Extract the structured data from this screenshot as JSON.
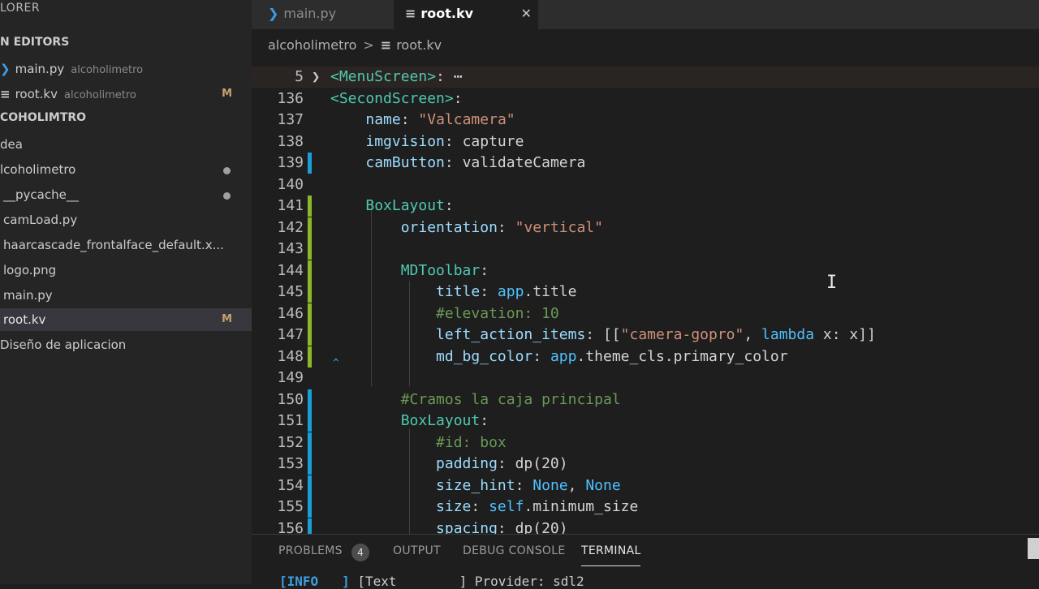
{
  "sidebar": {
    "explorer_title": "LORER",
    "open_editors_header": "N EDITORS",
    "open_editors": [
      {
        "icon": "python-file-icon",
        "name": "main.py",
        "description": "alcoholimetro",
        "modified": ""
      },
      {
        "icon": "kv-file-icon",
        "name": "root.kv",
        "description": "alcoholimetro",
        "modified": "M"
      }
    ],
    "project_header": "COHOLIMTRO",
    "tree": [
      {
        "name": "dea",
        "badge": "",
        "dot": false
      },
      {
        "name": "lcoholimetro",
        "badge": "",
        "dot": true
      },
      {
        "name": "__pycache__",
        "badge": "",
        "dot": true
      },
      {
        "name": "camLoad.py",
        "badge": "",
        "dot": false
      },
      {
        "name": "haarcascade_frontalface_default.x...",
        "badge": "",
        "dot": false
      },
      {
        "name": "logo.png",
        "badge": "",
        "dot": false
      },
      {
        "name": "main.py",
        "badge": "",
        "dot": false
      },
      {
        "name": "root.kv",
        "badge": "M",
        "dot": false
      },
      {
        "name": "Diseño de aplicacion",
        "badge": "",
        "dot": false
      }
    ]
  },
  "tabs": {
    "main": "main.py",
    "root": "root.kv",
    "close": "✕"
  },
  "breadcrumb": {
    "folder": "alcoholimetro",
    "separator": ">",
    "file": "root.kv"
  },
  "editor": {
    "lines": [
      {
        "n": "5",
        "fold": "❯",
        "mark": "",
        "tokens": [
          [
            "tag",
            "<MenuScreen>"
          ],
          [
            "plain",
            ":"
          ],
          [
            "plain",
            " ⋯"
          ]
        ]
      },
      {
        "n": "136",
        "fold": "",
        "mark": "",
        "tokens": [
          [
            "tag",
            "<SecondScreen>"
          ],
          [
            "plain",
            ":"
          ]
        ]
      },
      {
        "n": "137",
        "fold": "",
        "mark": "",
        "tokens": [
          [
            "plain",
            "    "
          ],
          [
            "prop",
            "name"
          ],
          [
            "plain",
            ": "
          ],
          [
            "str",
            "\"Valcamera\""
          ]
        ]
      },
      {
        "n": "138",
        "fold": "",
        "mark": "",
        "tokens": [
          [
            "plain",
            "    "
          ],
          [
            "prop",
            "imgvision"
          ],
          [
            "plain",
            ": capture"
          ]
        ]
      },
      {
        "n": "139",
        "fold": "",
        "mark": "blue",
        "tokens": [
          [
            "plain",
            "    "
          ],
          [
            "prop",
            "camButton"
          ],
          [
            "plain",
            ": validateCamera"
          ]
        ]
      },
      {
        "n": "140",
        "fold": "",
        "mark": "",
        "tokens": []
      },
      {
        "n": "141",
        "fold": "",
        "mark": "green",
        "tokens": [
          [
            "plain",
            "    "
          ],
          [
            "tag",
            "BoxLayout"
          ],
          [
            "plain",
            ":"
          ]
        ]
      },
      {
        "n": "142",
        "fold": "",
        "mark": "green",
        "tokens": [
          [
            "plain",
            "        "
          ],
          [
            "prop",
            "orientation"
          ],
          [
            "plain",
            ": "
          ],
          [
            "str",
            "\"vertical\""
          ]
        ]
      },
      {
        "n": "143",
        "fold": "",
        "mark": "green",
        "tokens": []
      },
      {
        "n": "144",
        "fold": "",
        "mark": "green",
        "tokens": [
          [
            "plain",
            "        "
          ],
          [
            "tag",
            "MDToolbar"
          ],
          [
            "plain",
            ":"
          ]
        ]
      },
      {
        "n": "145",
        "fold": "",
        "mark": "green",
        "tokens": [
          [
            "plain",
            "            "
          ],
          [
            "prop",
            "title"
          ],
          [
            "plain",
            ": "
          ],
          [
            "kw",
            "app"
          ],
          [
            "plain",
            ".title"
          ]
        ]
      },
      {
        "n": "146",
        "fold": "",
        "mark": "green",
        "tokens": [
          [
            "plain",
            "            "
          ],
          [
            "com",
            "#elevation: 10"
          ]
        ]
      },
      {
        "n": "147",
        "fold": "",
        "mark": "green",
        "tokens": [
          [
            "plain",
            "            "
          ],
          [
            "prop",
            "left_action_items"
          ],
          [
            "plain",
            ": [["
          ],
          [
            "str",
            "\"camera-gopro\""
          ],
          [
            "plain",
            ", "
          ],
          [
            "kw",
            "lambda"
          ],
          [
            "plain",
            " x: x]]"
          ]
        ]
      },
      {
        "n": "148",
        "fold": "",
        "mark": "green",
        "tokens": [
          [
            "plain",
            "            "
          ],
          [
            "prop",
            "md_bg_color"
          ],
          [
            "plain",
            ": "
          ],
          [
            "kw",
            "app"
          ],
          [
            "plain",
            ".theme_cls.primary_color"
          ]
        ]
      },
      {
        "n": "149",
        "fold": "",
        "mark": "",
        "tokens": []
      },
      {
        "n": "150",
        "fold": "",
        "mark": "blue",
        "tokens": [
          [
            "plain",
            "        "
          ],
          [
            "com",
            "#Cramos la caja principal"
          ]
        ]
      },
      {
        "n": "151",
        "fold": "",
        "mark": "blue",
        "tokens": [
          [
            "plain",
            "        "
          ],
          [
            "tag",
            "BoxLayout"
          ],
          [
            "plain",
            ":"
          ]
        ]
      },
      {
        "n": "152",
        "fold": "",
        "mark": "blue",
        "tokens": [
          [
            "plain",
            "            "
          ],
          [
            "com",
            "#id: box"
          ]
        ]
      },
      {
        "n": "153",
        "fold": "",
        "mark": "blue",
        "tokens": [
          [
            "plain",
            "            "
          ],
          [
            "prop",
            "padding"
          ],
          [
            "plain",
            ": dp(20)"
          ]
        ]
      },
      {
        "n": "154",
        "fold": "",
        "mark": "blue",
        "tokens": [
          [
            "plain",
            "            "
          ],
          [
            "prop",
            "size_hint"
          ],
          [
            "plain",
            ": "
          ],
          [
            "kw",
            "None"
          ],
          [
            "plain",
            ", "
          ],
          [
            "kw",
            "None"
          ]
        ]
      },
      {
        "n": "155",
        "fold": "",
        "mark": "blue",
        "tokens": [
          [
            "plain",
            "            "
          ],
          [
            "prop",
            "size"
          ],
          [
            "plain",
            ": "
          ],
          [
            "kw",
            "self"
          ],
          [
            "plain",
            ".minimum_size"
          ]
        ]
      },
      {
        "n": "156",
        "fold": "",
        "mark": "blue",
        "tokens": [
          [
            "plain",
            "            "
          ],
          [
            "prop",
            "spacing"
          ],
          [
            "plain",
            ": dp(20)"
          ]
        ]
      }
    ]
  },
  "panel": {
    "problems": "PROBLEMS",
    "problems_count": "4",
    "output": "OUTPUT",
    "debug_console": "DEBUG CONSOLE",
    "terminal": "TERMINAL",
    "terminal_line_tag": "[INFO   ]",
    "terminal_line_text": " [Text        ] Provider: sdl2"
  },
  "colors": {
    "accent_blue": "#1b9fd8",
    "accent_green": "#8fb829",
    "modified": "#c5a16b"
  }
}
